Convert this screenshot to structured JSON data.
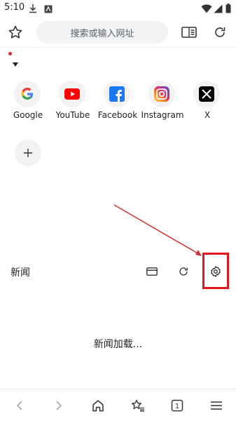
{
  "status_bar": {
    "time": "5:10",
    "icons": [
      "download-icon",
      "app-notification-icon",
      "wifi-icon",
      "signal-icon",
      "battery-icon"
    ]
  },
  "toolbar": {
    "address_placeholder": "搜索或输入网址",
    "icons": [
      "bookmark-star-icon",
      "reader-mode-icon",
      "refresh-icon"
    ]
  },
  "shortcuts": [
    {
      "label": "Google",
      "icon": "google-icon"
    },
    {
      "label": "YouTube",
      "icon": "youtube-icon"
    },
    {
      "label": "Facebook",
      "icon": "facebook-icon"
    },
    {
      "label": "Instagram",
      "icon": "instagram-icon"
    },
    {
      "label": "X",
      "icon": "x-icon"
    }
  ],
  "add_shortcut": {
    "icon": "plus-icon"
  },
  "news": {
    "title": "新闻",
    "loading_text": "新闻加载...",
    "icons": [
      "card-view-icon",
      "refresh-icon",
      "settings-gear-icon"
    ]
  },
  "annotation": {
    "highlight_color": "#e0161b",
    "arrow_color": "#d32f2f"
  },
  "bottom_nav": {
    "icons": [
      "back-icon",
      "forward-icon",
      "home-icon",
      "bookmarks-icon",
      "tabs-icon",
      "menu-icon"
    ],
    "tab_count": "1"
  },
  "colors": {
    "accent": "#e0161b",
    "text": "#1f1f1f",
    "muted": "#9e9e9e"
  }
}
